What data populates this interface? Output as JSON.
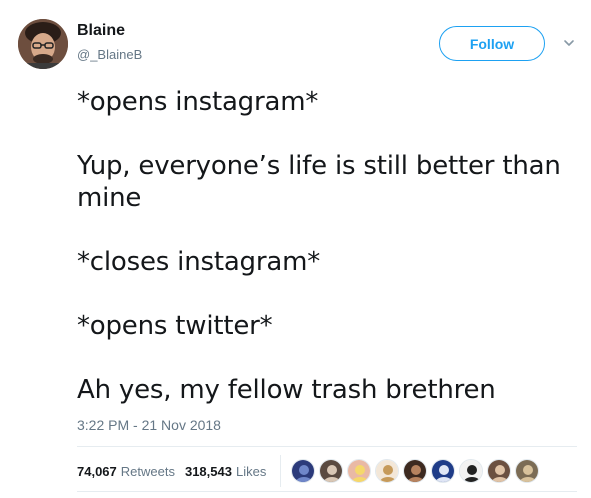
{
  "user": {
    "name": "Blaine",
    "handle": "@_BlaineB"
  },
  "follow_label": "Follow",
  "tweet": {
    "lines": [
      "*opens instagram*",
      "",
      "Yup, everyone’s life is still better than",
      "mine",
      "",
      "*closes instagram*",
      "",
      "*opens twitter*",
      "",
      "Ah yes, my fellow trash brethren"
    ],
    "timestamp": "3:22 PM - 21 Nov 2018"
  },
  "stats": {
    "retweets_count": "74,067",
    "retweets_label": "Retweets",
    "likes_count": "318,543",
    "likes_label": "Likes"
  },
  "colors": {
    "accent": "#1da1f2",
    "secondary_text": "#657786",
    "divider": "#e6ecf0"
  },
  "likers": [
    {
      "bg": "#2b3a7a",
      "fg": "#6f86c9"
    },
    {
      "bg": "#5a4a40",
      "fg": "#d9c7b5"
    },
    {
      "bg": "#e9b9a5",
      "fg": "#f5d86b"
    },
    {
      "bg": "#f3e7d8",
      "fg": "#c69a5a"
    },
    {
      "bg": "#3d2a20",
      "fg": "#b7835f"
    },
    {
      "bg": "#1f3c88",
      "fg": "#e0e6f5"
    },
    {
      "bg": "#f2f2f2",
      "fg": "#222222"
    },
    {
      "bg": "#6b5040",
      "fg": "#e0c3a6"
    },
    {
      "bg": "#7b6c55",
      "fg": "#d8c29c"
    }
  ]
}
